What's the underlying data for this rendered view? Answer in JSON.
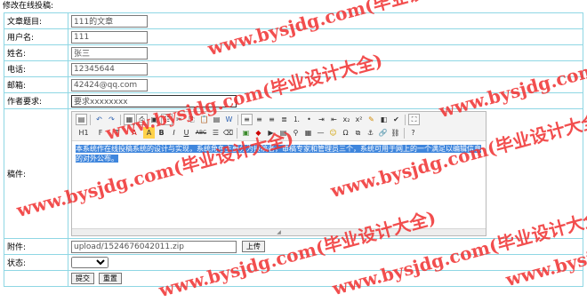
{
  "page": {
    "title": "修改在线投稿:"
  },
  "fields": {
    "article_title": {
      "label": "文章题目:",
      "value": "111的文章"
    },
    "username": {
      "label": "用户名:",
      "value": "111"
    },
    "name": {
      "label": "姓名:",
      "value": "张三"
    },
    "phone": {
      "label": "电话:",
      "value": "12345644"
    },
    "email": {
      "label": "邮箱:",
      "value": "42424@qq.com"
    },
    "author_req": {
      "label": "作者要求:",
      "value": "要求xxxxxxxx"
    },
    "manuscript": {
      "label": "稿件:",
      "content": "    本系统作在线投稿系统的设计与实现，系统角色主要分为投稿者，审稿专家和管理员三个，系统可用于网上的一个满足以编辑信息的对外公布。"
    },
    "attachment": {
      "label": "附件:",
      "value": "upload/1524676042011.zip",
      "upload_button": "上传"
    },
    "status": {
      "label": "状态:",
      "value": ""
    }
  },
  "actions": {
    "submit": "提交",
    "reset": "重置"
  },
  "toolbar": {
    "row1": [
      "source-icon",
      "undo-icon",
      "redo-icon",
      "template-icon",
      "print-icon",
      "preview-icon",
      "cut-icon",
      "copy-icon",
      "paste-icon",
      "paste-text-icon",
      "paste-word-icon",
      "align-left-icon",
      "align-center-icon",
      "align-right-icon",
      "justify-icon",
      "ordered-list-icon",
      "unordered-list-icon",
      "indent-icon",
      "outdent-icon",
      "subscript-icon",
      "superscript-icon",
      "clear-format-icon",
      "select-all-icon",
      "fullscreen-icon"
    ],
    "row2_labels": {
      "heading": "H1",
      "font": "F",
      "size": "T",
      "font_color": "A",
      "bg_color": "A",
      "bold": "B",
      "italic": "I",
      "underline": "U",
      "strike": "ABC"
    }
  },
  "watermark": "www.bysjdg.com(毕业设计大全)"
}
